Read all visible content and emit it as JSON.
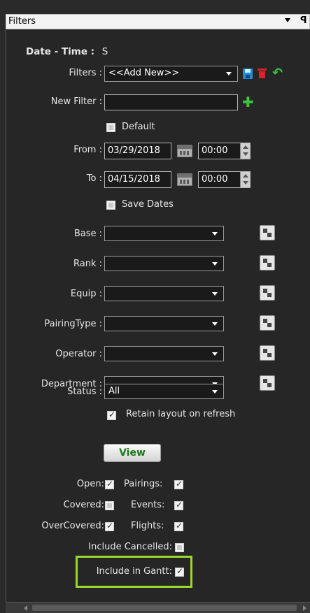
{
  "panel": {
    "title": "Filters",
    "pin_glyph": "ꟼ"
  },
  "header": {
    "date_time_label": "Date - Time :",
    "date_time_value": "S"
  },
  "filters": {
    "label": "Filters :",
    "selected": "<<Add New>>"
  },
  "new_filter": {
    "label": "New Filter :",
    "value": ""
  },
  "default": {
    "label": "Default",
    "checked": false
  },
  "from": {
    "label": "From :",
    "date": "03/29/2018",
    "time": "00:00"
  },
  "to": {
    "label": "To :",
    "date": "04/15/2018",
    "time": "00:00"
  },
  "save_dates": {
    "label": "Save Dates",
    "checked": false
  },
  "selectors": [
    {
      "label": "Base :",
      "value": ""
    },
    {
      "label": "Rank :",
      "value": ""
    },
    {
      "label": "Equip :",
      "value": ""
    },
    {
      "label": "PairingType :",
      "value": ""
    },
    {
      "label": "Operator :",
      "value": ""
    },
    {
      "label": "Department :",
      "value": ""
    }
  ],
  "status": {
    "label": "Status :",
    "value": "All"
  },
  "retain_layout": {
    "label": "Retain layout on refresh",
    "checked": true
  },
  "view_button": "View",
  "options": {
    "open": {
      "label": "Open:",
      "checked": true
    },
    "pairings": {
      "label": "Pairings:",
      "checked": true
    },
    "covered": {
      "label": "Covered:",
      "checked": false
    },
    "events": {
      "label": "Events:",
      "checked": true
    },
    "overcovered": {
      "label": "OverCovered:",
      "checked": true
    },
    "flights": {
      "label": "Flights:",
      "checked": true
    },
    "include_cancelled": {
      "label": "Include Cancelled:",
      "checked": false
    },
    "include_in_gantt": {
      "label": "Include in Gantt:",
      "checked": true
    }
  },
  "colors": {
    "highlight": "#9ad82a",
    "save_icon": "#1e8fd6",
    "delete_icon": "#d9232a",
    "add_icon": "#3cc43c"
  },
  "icons": {
    "save": "save-icon",
    "delete": "trash-icon",
    "undo": "undo-icon",
    "add": "plus-icon",
    "calendar": "calendar-icon",
    "multi_select": "multi-select-icon"
  }
}
